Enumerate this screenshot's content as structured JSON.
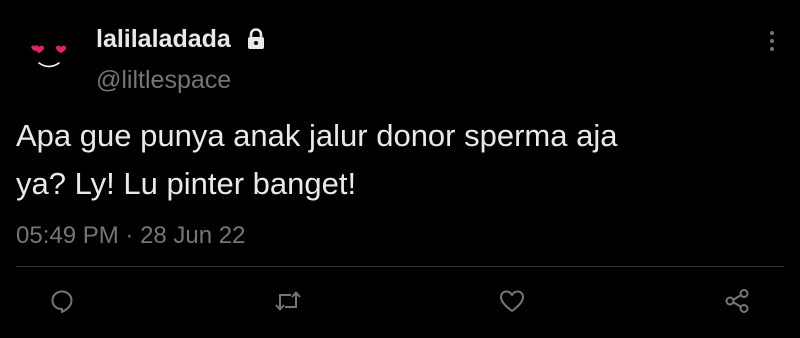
{
  "tweet": {
    "display_name": "lalilaladada",
    "handle": "@liltlespace",
    "text_line1": "Apa gue punya anak jalur donor sperma aja",
    "text_line2": "ya? Ly! Lu pinter banget!",
    "time": "05:49 PM",
    "separator": " · ",
    "date": "28 Jun 22",
    "protected": true
  },
  "icons": {
    "avatar": "heart-eyes-face",
    "lock": "lock-icon",
    "more": "vertical-ellipsis-icon",
    "reply": "comment-bubble-icon",
    "retweet": "retweet-arrows-icon",
    "like": "heart-outline-icon",
    "share": "share-nodes-icon"
  },
  "colors": {
    "background": "#000000",
    "primary_text": "#e7e9ea",
    "secondary_text": "#71767b",
    "divider": "#2f3336",
    "avatar_hearts": "#e0245e"
  }
}
